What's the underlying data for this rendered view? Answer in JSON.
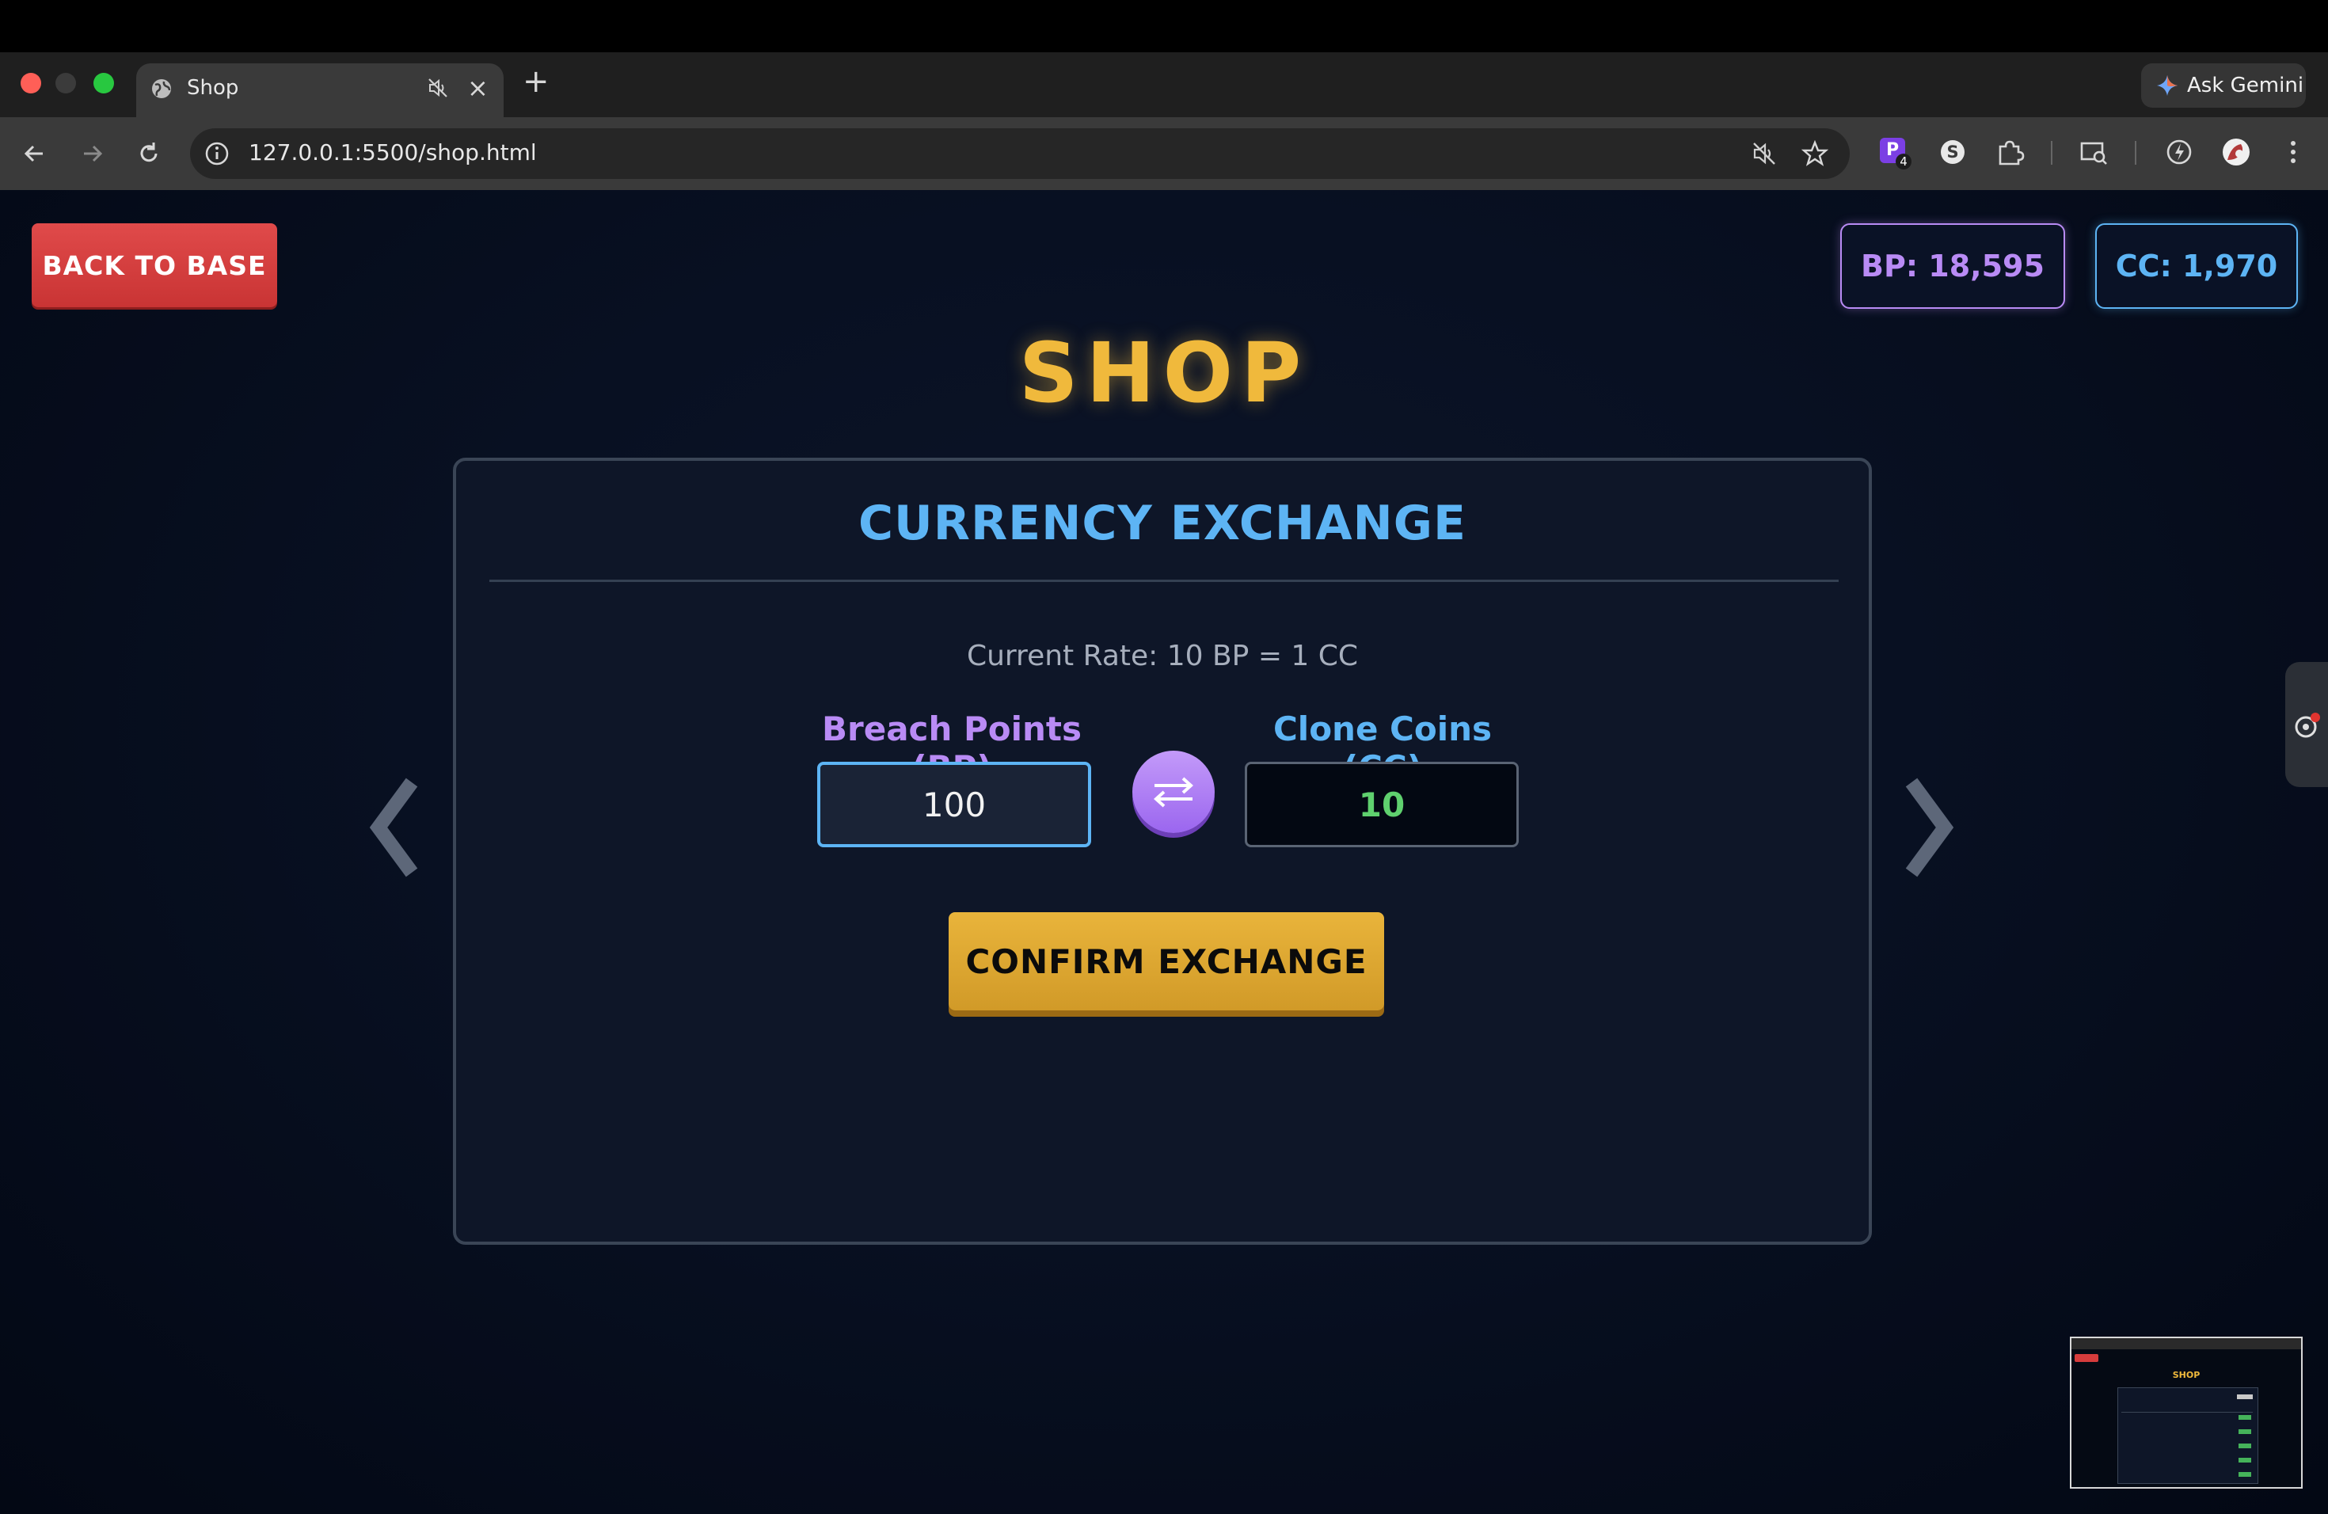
{
  "browser": {
    "tab_title": "Shop",
    "tab_close": "×",
    "new_tab": "+",
    "url": "127.0.0.1:5500/shop.html",
    "ask_gemini": "Ask Gemini",
    "extension_badge": "4",
    "extension_letter": "P"
  },
  "header": {
    "back_label": "BACK TO BASE",
    "bp_badge": "BP: 18,595",
    "cc_badge": "CC: 1,970"
  },
  "page_title": "SHOP",
  "exchange": {
    "title": "CURRENCY EXCHANGE",
    "rate": "Current Rate: 10 BP = 1 CC",
    "bp_label": "Breach Points (BP)",
    "cc_label": "Clone Coins (CC)",
    "bp_value": "100",
    "cc_value": "10",
    "confirm_label": "CONFIRM EXCHANGE"
  },
  "colors": {
    "accent_gold": "#f0b93c",
    "accent_blue": "#5db4f4",
    "accent_purple": "#b98bf5",
    "danger_red": "#d63c3c",
    "success_green": "#5fd06e"
  },
  "thumbnail": {
    "title": "SHOP"
  }
}
